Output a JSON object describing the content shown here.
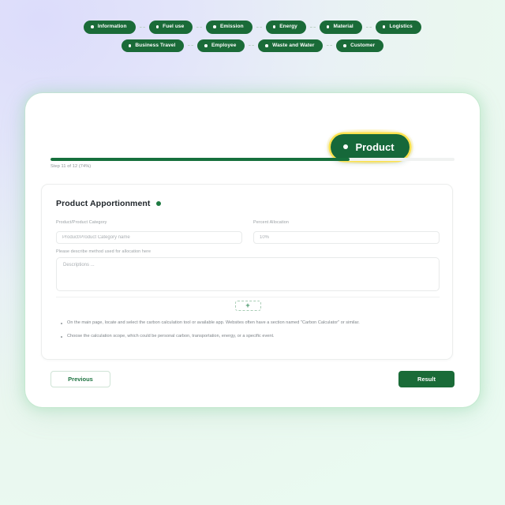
{
  "stepper": {
    "row1": [
      {
        "label": "Information"
      },
      {
        "label": "Fuel use"
      },
      {
        "label": "Emission"
      },
      {
        "label": "Energy"
      },
      {
        "label": "Material"
      },
      {
        "label": "Logistics"
      }
    ],
    "row2": [
      {
        "label": "Business Travel"
      },
      {
        "label": "Employee"
      },
      {
        "label": "Waste and Water"
      },
      {
        "label": "Customer"
      }
    ],
    "active": {
      "label": "Product"
    }
  },
  "progress": {
    "percent": 74,
    "step_label": "Step 11 of 12 (74%)"
  },
  "card": {
    "title": "Product Apportionment",
    "fields": {
      "product_category": {
        "label": "Product/Product Category",
        "placeholder": "Product/Product Category name",
        "value": ""
      },
      "percent_allocation": {
        "label": "Percent Allocation",
        "placeholder": "10%",
        "value": ""
      },
      "description": {
        "label": "Please describe method used for allocation here",
        "placeholder": "Descriptions ...",
        "value": ""
      }
    },
    "add_button_label": "+",
    "bullets": [
      "On the main page, locate and select the carbon calculation tool or available app. Websites often have a section named \"Carbon Calculator\" or similar.",
      "Choose the calculation scope, which could be personal carbon, transportation, energy, or a specific event."
    ]
  },
  "footer": {
    "previous_label": "Previous",
    "result_label": "Result"
  },
  "colors": {
    "brand_green": "#1a6b38",
    "progress_green": "#16703c",
    "glow_yellow": "#ffe248",
    "badge_green": "#1e7a42"
  }
}
